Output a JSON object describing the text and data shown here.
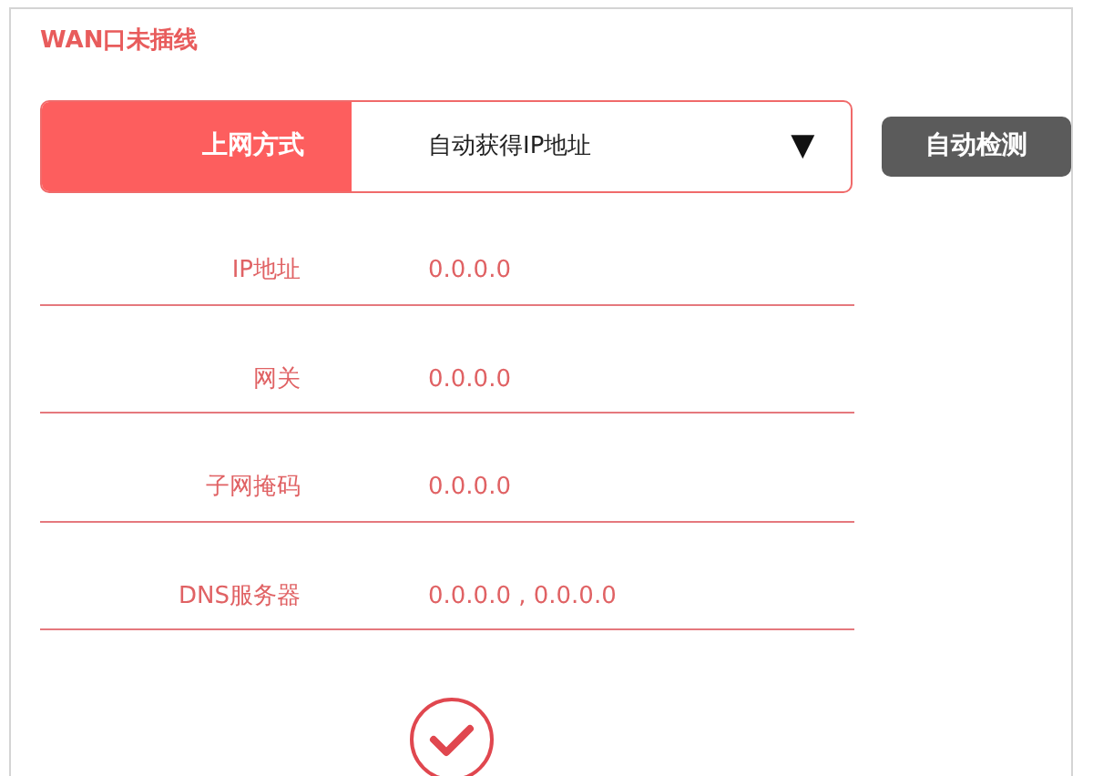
{
  "title": "WAN口未插线",
  "connection": {
    "label": "上网方式",
    "value": "自动获得IP地址",
    "caret": "▼"
  },
  "detect_button": "自动检测",
  "fields": [
    {
      "label": "IP地址",
      "value": "0.0.0.0"
    },
    {
      "label": "网关",
      "value": "0.0.0.0"
    },
    {
      "label": "子网掩码",
      "value": "0.0.0.0"
    },
    {
      "label": "DNS服务器",
      "value": "0.0.0.0 , 0.0.0.0"
    }
  ]
}
